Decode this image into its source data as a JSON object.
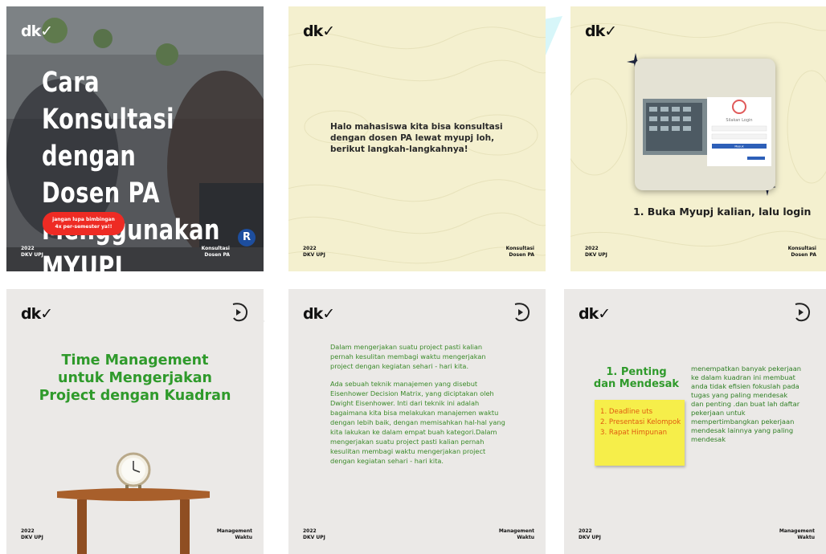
{
  "brand": {
    "logo": "dk✓"
  },
  "tiles": {
    "t1": {
      "title_lines": [
        "Cara Konsultasi",
        "dengan Dosen PA",
        "Menggunakan",
        "MYUPJ"
      ],
      "pill": [
        "jangan lupa bimbingan",
        "4x per-semester ya!!"
      ],
      "foot_left": [
        "2022",
        "DKV UPJ"
      ],
      "foot_right": [
        "Konsultasi",
        "Dosen PA"
      ],
      "badge": "R"
    },
    "t2": {
      "text": "Halo mahasiswa kita bisa konsultasi dengan dosen PA lewat myupj loh, berikut langkah-langkahnya!",
      "foot_left": [
        "2022",
        "DKV UPJ"
      ],
      "foot_right": [
        "Konsultasi",
        "Dosen PA"
      ]
    },
    "t3": {
      "login_title": "Silakan Login",
      "login_button": "Masuk",
      "step": "1. Buka Myupj kalian, lalu login",
      "foot_left": [
        "2022",
        "DKV UPJ"
      ],
      "foot_right": [
        "Konsultasi",
        "Dosen PA"
      ]
    },
    "t4": {
      "title": [
        "Time Management",
        "untuk Mengerjakan",
        "Project dengan Kuadran"
      ],
      "foot_left": [
        "2022",
        "DKV UPJ"
      ],
      "foot_right": [
        "Management",
        "Waktu"
      ]
    },
    "t5": {
      "p1": "Dalam mengerjakan suatu project pasti kalian pernah kesulitan membagi waktu mengerjakan project dengan kegiatan sehari - hari kita.",
      "p2": "Ada sebuah teknik manajemen yang disebut Eisenhower Decision Matrix, yang diciptakan oleh Dwight Eisenhower. Inti dari teknik ini adalah bagaimana kita bisa melakukan manajemen waktu dengan lebih baik, dengan memisahkan hal-hal yang kita lakukan ke dalam empat buah kategori.Dalam mengerjakan suatu project pasti kalian pernah kesulitan membagi waktu mengerjakan project dengan kegiatan sehari - hari kita.",
      "foot_left": [
        "2022",
        "DKV UPJ"
      ],
      "foot_right": [
        "Management",
        "Waktu"
      ]
    },
    "t6": {
      "heading": [
        "1. Penting",
        "dan Mendesak"
      ],
      "list": [
        "1. Deadline uts",
        "2. Presentasi Kelompok",
        "3. Rapat Himpunan"
      ],
      "text": "menempatkan banyak pekerjaan ke dalam kuadran ini membuat anda tidak efisien fokuslah pada tugas yang paling mendesak dan penting .dan buat lah daftar pekerjaan untuk mempertimbangkan pekerjaan  mendesak lainnya yang paling mendesak",
      "foot_left": [
        "2022",
        "DKV UPJ"
      ],
      "foot_right": [
        "Management",
        "Waktu"
      ]
    }
  },
  "colors": {
    "green": "#2f9a2b",
    "cream": "#f4f0cf",
    "gray": "#ebe9e7",
    "red": "#ee2b24"
  }
}
